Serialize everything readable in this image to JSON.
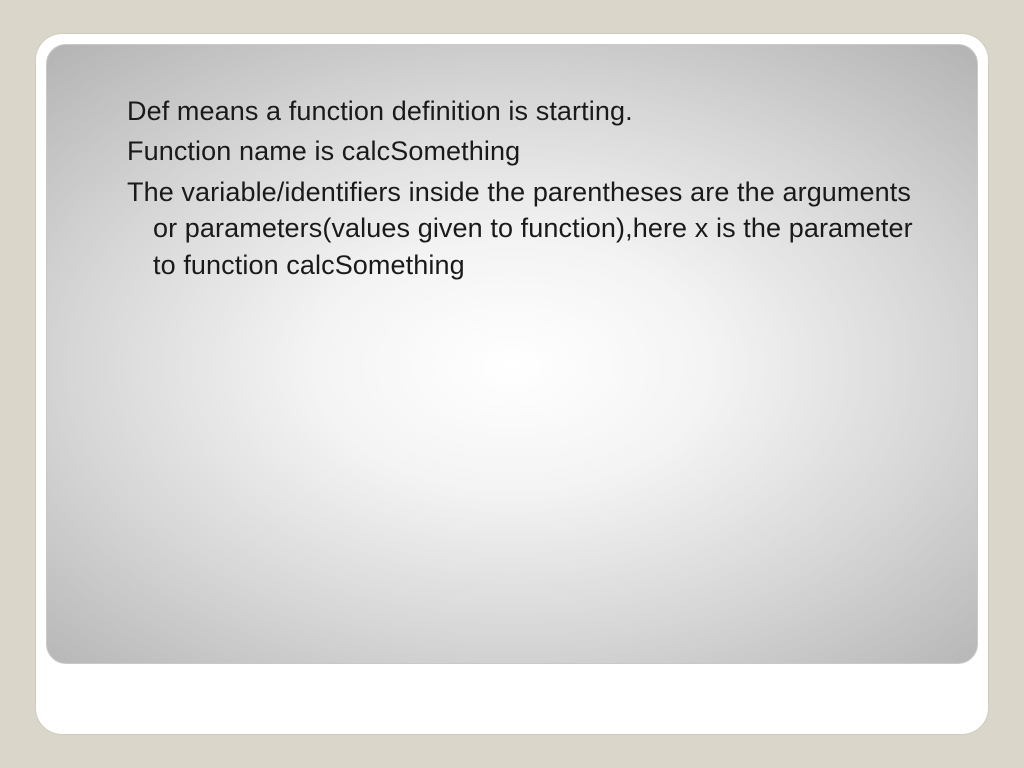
{
  "slide": {
    "line1": "Def  means a function definition is starting.",
    "line2": "Function name is calcSomething",
    "para": "The variable/identifiers inside the parentheses are the arguments or parameters(values given to function),here x is the parameter to function calcSomething"
  }
}
